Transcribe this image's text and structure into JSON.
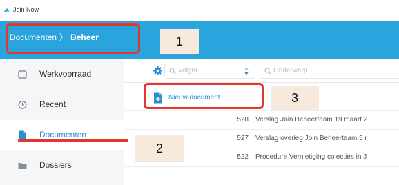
{
  "app": {
    "name": "Join Now",
    "icon": "join-now-logo-icon"
  },
  "header": {
    "breadcrumb": {
      "parent": "Documenten",
      "separator": "〉",
      "current": "Beheer"
    }
  },
  "sidebar": {
    "items": [
      {
        "label": "Werkvoorraad",
        "icon": "inbox-icon",
        "active": false
      },
      {
        "label": "Recent",
        "icon": "clock-icon",
        "active": false
      },
      {
        "label": "Documenten",
        "icon": "document-icon",
        "active": true
      },
      {
        "label": "Dossiers",
        "icon": "folder-icon",
        "active": false
      }
    ]
  },
  "filters": {
    "volgnr": {
      "placeholder": "Volgnr."
    },
    "onderwerp": {
      "placeholder": "Onderwerp"
    }
  },
  "new_document": {
    "label": "Nieuw document"
  },
  "documents": [
    {
      "number": "528",
      "subject": "Verslag Join Beheerteam 19 maart 2"
    },
    {
      "number": "527",
      "subject": "Verslag overleg Join Beheerteam 5 r"
    },
    {
      "number": "522",
      "subject": "Procedure Vernietiging colecties in J"
    }
  ],
  "annotations": [
    {
      "number": "1"
    },
    {
      "number": "2"
    },
    {
      "number": "3"
    }
  ],
  "colors": {
    "header": "#2aa4dc",
    "accent": "#2a8fd0",
    "callout": "#e8342f",
    "callout_fill": "#f7e9dc"
  }
}
